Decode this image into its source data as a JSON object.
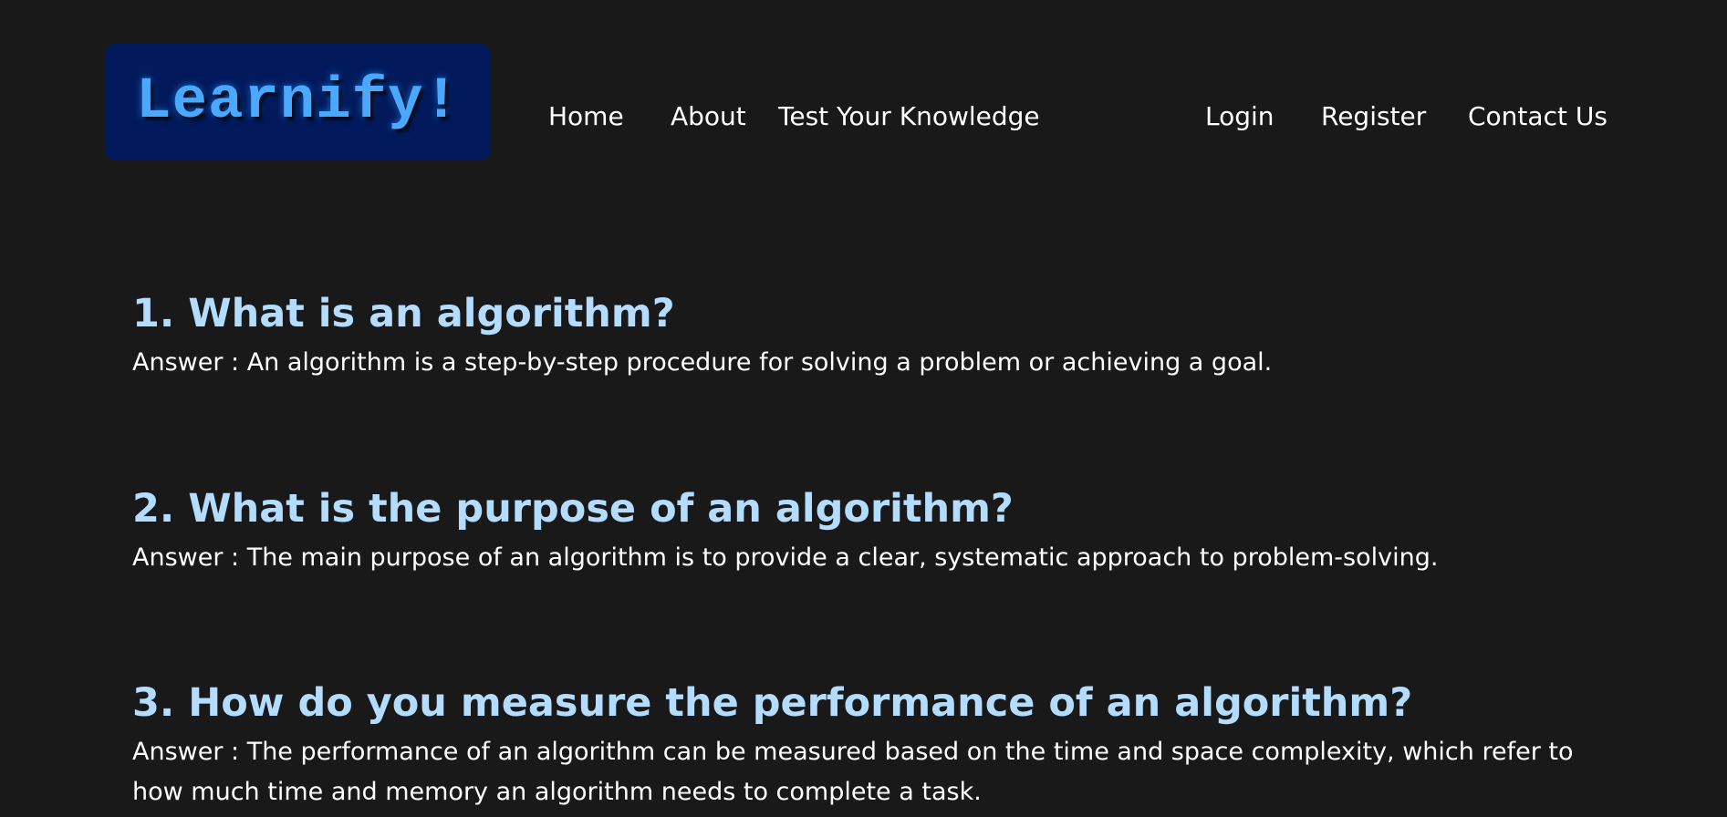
{
  "header": {
    "logo_text": "Learnify!",
    "nav_left": [
      {
        "label": "Home"
      },
      {
        "label": "About"
      },
      {
        "label": "Test Your Knowledge"
      }
    ],
    "nav_right": [
      {
        "label": "Login"
      },
      {
        "label": "Register"
      },
      {
        "label": "Contact Us"
      }
    ]
  },
  "faq": [
    {
      "question": "1. What is an algorithm?",
      "answer": "Answer : An algorithm is a step-by-step procedure for solving a problem or achieving a goal."
    },
    {
      "question": "2. What is the purpose of an algorithm?",
      "answer": "Answer : The main purpose of an algorithm is to provide a clear, systematic approach to problem-solving."
    },
    {
      "question": "3. How do you measure the performance of an algorithm?",
      "answer": "Answer : The performance of an algorithm can be measured based on the time and space complexity, which refer to how much time and memory an algorithm needs to complete a task."
    }
  ],
  "colors": {
    "background": "#191919",
    "logo_background": "#021a5c",
    "logo_text": "#4aa8ff",
    "question_text": "#b4dcff",
    "body_text": "#ffffff"
  }
}
